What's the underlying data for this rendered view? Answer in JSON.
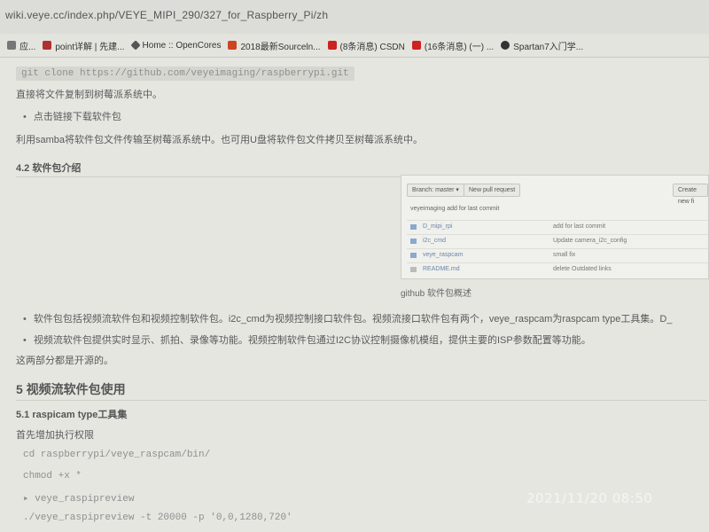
{
  "address": {
    "url": "wiki.veye.cc/index.php/VEYE_MIPI_290/327_for_Raspberry_Pi/zh"
  },
  "bookmarks": [
    {
      "label": "应...",
      "color": "#777777"
    },
    {
      "label": "point详解 | 先建...",
      "color": "#b03030"
    },
    {
      "label": "Home :: OpenCores",
      "color": "#555555"
    },
    {
      "label": "2018最新Sourceln...",
      "color": "#cc4422"
    },
    {
      "label": "(8条消息) CSDN",
      "color": "#cc2222"
    },
    {
      "label": "(16条消息) (一) ...",
      "color": "#cc2222"
    },
    {
      "label": "Spartan7入门学...",
      "color": "#333333"
    }
  ],
  "content": {
    "clone_cmd": "git clone https://github.com/veyeimaging/raspberrypi.git",
    "line1": "直接将文件复制到树莓派系统中。",
    "bullet1": "点击链接下载软件包",
    "line2": "利用samba将软件包文件传输至树莓派系统中。也可用U盘将软件包文件拷贝至树莓派系统中。",
    "h42": "4.2 软件包介绍",
    "github": {
      "branch_btn": "Branch: master ▾",
      "pull_btn": "New pull request",
      "right_btn": "Create new fi",
      "commit": "veyeimaging add for last commit",
      "rows": [
        {
          "name": "D_mipi_rpi",
          "msg": "add for last commit"
        },
        {
          "name": "i2c_cmd",
          "msg": "Update camera_i2c_config"
        },
        {
          "name": "veye_raspcam",
          "msg": "small fix"
        },
        {
          "name": "README.md",
          "msg": "delete Outdated links"
        }
      ]
    },
    "caption": "github 软件包概述",
    "bullet2": "软件包包括视频流软件包和视频控制软件包。i2c_cmd为视频控制接口软件包。视频流接口软件包有两个，veye_raspcam为raspcam type工具集。D_",
    "bullet3": "视频流软件包提供实时显示、抓拍、录像等功能。视频控制软件包通过I2C协议控制摄像机模组，提供主要的ISP参数配置等功能。",
    "line3": "这两部分都是开源的。",
    "h5": "5 视频流软件包使用",
    "h51": "5.1 raspicam type工具集",
    "line4": "首先增加执行权限",
    "cmd1": "cd raspberrypi/veye_raspcam/bin/",
    "cmd2": "chmod +x *",
    "cmd3": "▸ veye_raspipreview",
    "cmd4": "./veye_raspipreview -t 20000 -p '0,0,1280,720'"
  },
  "timestamp": "2021/11/20  08:50"
}
